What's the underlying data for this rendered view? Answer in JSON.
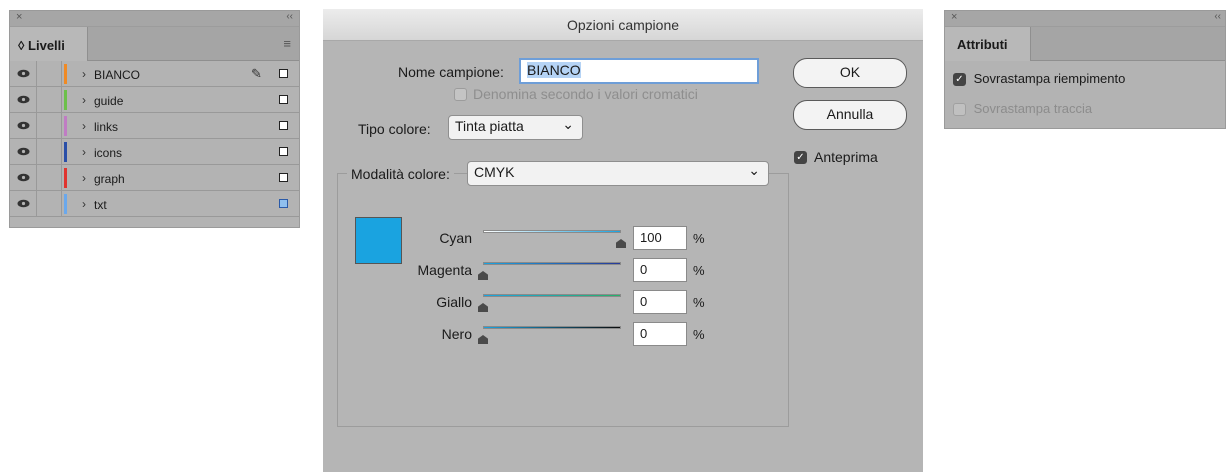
{
  "layers_panel": {
    "close_glyph": "×",
    "collapse_glyph": "‹‹",
    "tab_label": "◊ Livelli",
    "menu_glyph": "≡",
    "layers": [
      {
        "name": "BIANCO",
        "color": "#f08a24",
        "pen": "✎",
        "target_color": "#ffffff"
      },
      {
        "name": "guide",
        "color": "#6cc04a",
        "pen": "",
        "target_color": "#ffffff"
      },
      {
        "name": "links",
        "color": "#c07cc4",
        "pen": "",
        "target_color": "#ffffff"
      },
      {
        "name": "icons",
        "color": "#2a4fa8",
        "pen": "",
        "target_color": "#ffffff"
      },
      {
        "name": "graph",
        "color": "#e0332e",
        "pen": "",
        "target_color": "#ffffff"
      },
      {
        "name": "txt",
        "color": "#6aa8ec",
        "pen": "",
        "target_color": "#8fbfee"
      }
    ],
    "chevron": "›"
  },
  "dialog": {
    "title": "Opzioni campione",
    "name_label": "Nome campione:",
    "name_value": "BIANCO",
    "name_by_value_label": "Denomina secondo i valori cromatici",
    "color_type_label": "Tipo colore:",
    "color_type_value": "Tinta piatta",
    "color_mode_label": "Modalità colore:",
    "color_mode_value": "CMYK",
    "ok_label": "OK",
    "cancel_label": "Annulla",
    "preview_label": "Anteprima",
    "preview_checked": "✓",
    "swatch_color": "#1aa3e0",
    "dropdown_glyph": "⌄",
    "percent": "%",
    "sliders": [
      {
        "label": "Cyan",
        "value": "100",
        "level": 1.0,
        "track_from": "#ffffff",
        "track_to": "#1aa3e0"
      },
      {
        "label": "Magenta",
        "value": "0",
        "level": 0.0,
        "track_from": "#1aa3e0",
        "track_to": "#283a9a"
      },
      {
        "label": "Giallo",
        "value": "0",
        "level": 0.0,
        "track_from": "#1aa3e0",
        "track_to": "#27b16a"
      },
      {
        "label": "Nero",
        "value": "0",
        "level": 0.0,
        "track_from": "#1aa3e0",
        "track_to": "#0c0c0c"
      }
    ]
  },
  "attributes_panel": {
    "close_glyph": "×",
    "collapse_glyph": "‹‹",
    "tab_label": "Attributi",
    "fill_label": "Sovrastampa riempimento",
    "fill_checked": "✓",
    "stroke_label": "Sovrastampa traccia"
  }
}
